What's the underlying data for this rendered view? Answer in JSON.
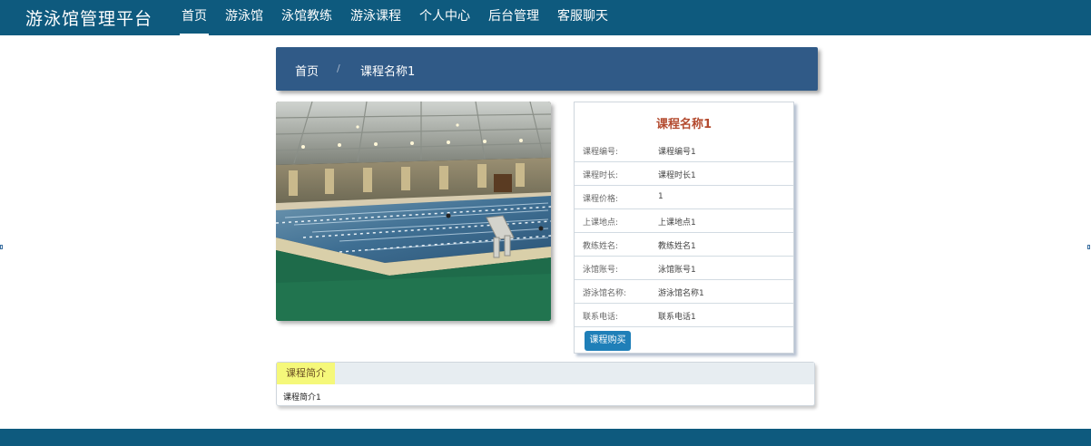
{
  "header": {
    "brand": "游泳馆管理平台",
    "nav": [
      "首页",
      "游泳馆",
      "泳馆教练",
      "游泳课程",
      "个人中心",
      "后台管理",
      "客服聊天"
    ],
    "active_index": 0
  },
  "breadcrumb": {
    "home": "首页",
    "separator": "/",
    "current": "课程名称1"
  },
  "detail": {
    "title": "课程名称1",
    "rows": [
      {
        "label": "课程编号:",
        "value": "课程编号1"
      },
      {
        "label": "课程时长:",
        "value": "课程时长1"
      },
      {
        "label": "课程价格:",
        "value": "1"
      },
      {
        "label": "上课地点:",
        "value": "上课地点1"
      },
      {
        "label": "教练姓名:",
        "value": "教练姓名1"
      },
      {
        "label": "泳馆账号:",
        "value": "泳馆账号1"
      },
      {
        "label": "游泳馆名称:",
        "value": "游泳馆名称1"
      },
      {
        "label": "联系电话:",
        "value": "联系电话1"
      }
    ],
    "buy_button": "课程购买"
  },
  "intro": {
    "tab_label": "课程简介",
    "text": "课程简介1"
  },
  "colors": {
    "header_bg": "#0e5a7e",
    "breadcrumb_bg": "#305a87",
    "title_color": "#b34a2e",
    "button_bg": "#1f7fb8",
    "intro_tab_bg": "#f5f87a"
  }
}
